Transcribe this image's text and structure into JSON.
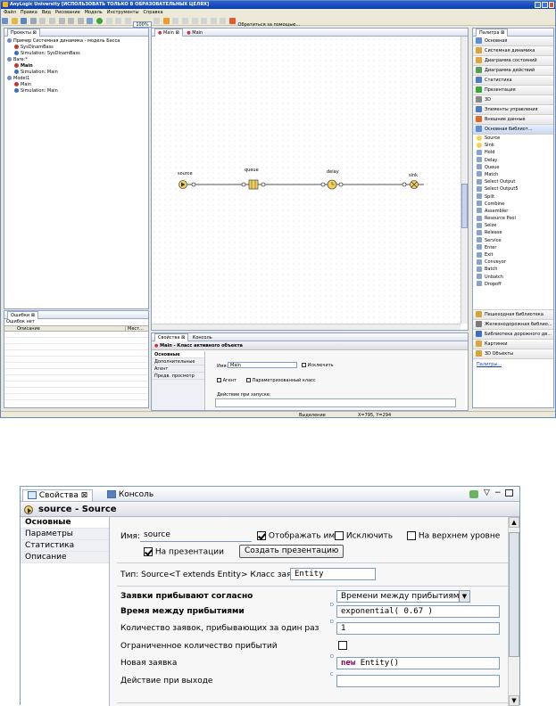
{
  "app": {
    "title": "AnyLogic University [ИСПОЛЬЗОВАТЬ ТОЛЬКО В ОБРАЗОВАТЕЛЬНЫХ ЦЕЛЯХ]",
    "menu": [
      "Файл",
      "Правка",
      "Вид",
      "Рисование",
      "Модель",
      "Инструменты",
      "Справка"
    ],
    "zoom": "100%",
    "help_link": "Обратиться за помощью..."
  },
  "projects": {
    "title": "Проекты",
    "tree": [
      "Пример Системная динамика - модель Басса",
      "SysDinamBass",
      "Simulation: SysDinamBass",
      "Bare:*",
      "Main",
      "Simulation: Main",
      "Model1",
      "Main",
      "Simulation: Main"
    ]
  },
  "editor": {
    "tabs": [
      "Main",
      "Main"
    ],
    "blocks": {
      "source": "source",
      "queue": "queue",
      "delay": "delay",
      "sink": "sink"
    }
  },
  "errors": {
    "title": "Ошибки",
    "status": "Ошибок нет",
    "columns": [
      "Описание",
      "Мест..."
    ]
  },
  "props_small": {
    "tabs": [
      "Свойства",
      "Консоль"
    ],
    "title": "Main - Класс активного объекта",
    "side": [
      "Основные",
      "Дополнительные",
      "Агент",
      "Предв. просмотр"
    ],
    "name_label": "Имя:",
    "name_value": "Main",
    "exclude": "Исключить",
    "agent": "Агент",
    "param_class": "Параметризованный класс",
    "startup": "Действие при запуске:"
  },
  "statusbar": {
    "selection": "Выделение",
    "coords": "X=795, Y=294"
  },
  "palette": {
    "title": "Палитра",
    "categories_top": [
      "Основная",
      "Системная динамика",
      "Диаграмма состояний",
      "Диаграмма действий",
      "Статистика",
      "Презентация",
      "3D",
      "Элементы управления",
      "Внешние данные",
      "Основная библиот..."
    ],
    "items": [
      "Source",
      "Sink",
      "Hold",
      "Delay",
      "Queue",
      "Match",
      "Select Output",
      "Select Output5",
      "Split",
      "Combine",
      "Assembler",
      "Resource Pool",
      "Seize",
      "Release",
      "Service",
      "Enter",
      "Exit",
      "Conveyor",
      "Batch",
      "Unbatch",
      "Dropoff"
    ],
    "categories_bottom": [
      "Пешеходная библиотека",
      "Железнодорожная библио...",
      "Библиотека дорожного дв...",
      "Картинки",
      "3D Объекты"
    ],
    "footer": "Палитры..."
  },
  "props_large": {
    "tabs": [
      "Свойства",
      "Консоль"
    ],
    "title": "source - Source",
    "side": [
      "Основные",
      "Параметры",
      "Статистика",
      "Описание"
    ],
    "name_label": "Имя:",
    "name_value": "source",
    "show_name": "Отображать имя",
    "exclude": "Исключить",
    "on_top": "На верхнем уровне",
    "on_presentation": "На презентации",
    "create_presentation": "Создать презентацию",
    "type_label": "Тип: Source<T extends Entity>  Класс заявки:",
    "class_value": "Entity",
    "rows": [
      {
        "label": "Заявки прибывают согласно",
        "value": "Времени между прибытиями",
        "kind": "select",
        "bold": true
      },
      {
        "label": "Время между прибытиями",
        "value": "exponential( 0.67 )",
        "kind": "code",
        "bold": true
      },
      {
        "label": "Количество заявок, прибывающих за один раз",
        "value": "1",
        "kind": "code",
        "bold": false
      },
      {
        "label": "Ограниченное количество прибытий",
        "value": "",
        "kind": "check",
        "bold": false
      },
      {
        "label": "Новая заявка",
        "value_kw": "new",
        "value": "Entity()",
        "kind": "new",
        "bold": false
      },
      {
        "label": "Действие при выходе",
        "value": "",
        "kind": "code",
        "bold": false
      }
    ]
  }
}
